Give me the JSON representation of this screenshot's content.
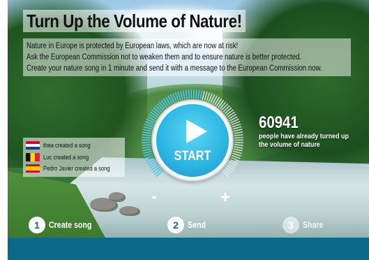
{
  "title": "Turn Up the Volume of Nature!",
  "intro": [
    "Nature in Europe is protected by European laws, which are now at risk!",
    "Ask the European Commission not to weaken them and to ensure nature is better protected.",
    "Create your nature song in 1 minute and send it with a message to the European Commission now."
  ],
  "counter": {
    "count": "60941",
    "text": "people have already turned up the volume of nature"
  },
  "recent": [
    {
      "flag": "netherlands-flag-icon",
      "label": "thea created a song"
    },
    {
      "flag": "belgium-flag-icon",
      "label": "Luc created a song"
    },
    {
      "flag": "spain-flag-icon",
      "label": "Pedro Javier created a song"
    }
  ],
  "dial": {
    "start_label": "START",
    "minus": "-",
    "plus": "+",
    "play_icon": "play-icon"
  },
  "steps": [
    {
      "number": "1",
      "label": "Create song"
    },
    {
      "number": "2",
      "label": "Send"
    },
    {
      "number": "3",
      "label": "Share"
    }
  ],
  "colors": {
    "accent": "#2fb7e4",
    "footer": "#0a6a87"
  }
}
